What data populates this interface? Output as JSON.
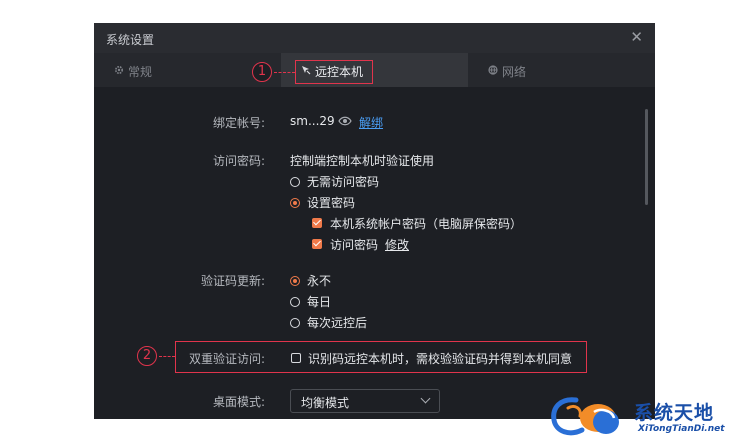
{
  "window": {
    "title": "系统设置"
  },
  "tabs": [
    {
      "label": "常规",
      "icon": "gear-icon"
    },
    {
      "label": "远控本机",
      "icon": "remote-control-icon",
      "active": true
    },
    {
      "label": "网络",
      "icon": "network-icon"
    }
  ],
  "account": {
    "label": "绑定帐号:",
    "value": "sm...29",
    "unbind": "解绑"
  },
  "password": {
    "label": "访问密码:",
    "desc": "控制端控制本机时验证使用",
    "options": [
      "无需访问密码",
      "设置密码"
    ],
    "selected": 1,
    "sub": [
      {
        "label": "本机系统帐户密码（电脑屏保密码）",
        "checked": true
      },
      {
        "label": "访问密码",
        "checked": true,
        "link": "修改"
      }
    ]
  },
  "code_update": {
    "label": "验证码更新:",
    "options": [
      "永不",
      "每日",
      "每次远控后"
    ],
    "selected": 0
  },
  "dual_verify": {
    "label": "双重验证访问:",
    "checkbox_label": "识别码远控本机时，需校验验证码并得到本机同意",
    "checked": false
  },
  "desktop_mode": {
    "label": "桌面模式:",
    "value": "均衡模式"
  },
  "annotations": {
    "one": "1",
    "two": "2"
  },
  "watermark": {
    "title": "系统天地",
    "url": "XiTongTianDi.net"
  },
  "colors": {
    "accent": "#f07a4a",
    "link": "#4a9ef5",
    "annotation": "#e0344c",
    "background": "#1d1f24"
  }
}
